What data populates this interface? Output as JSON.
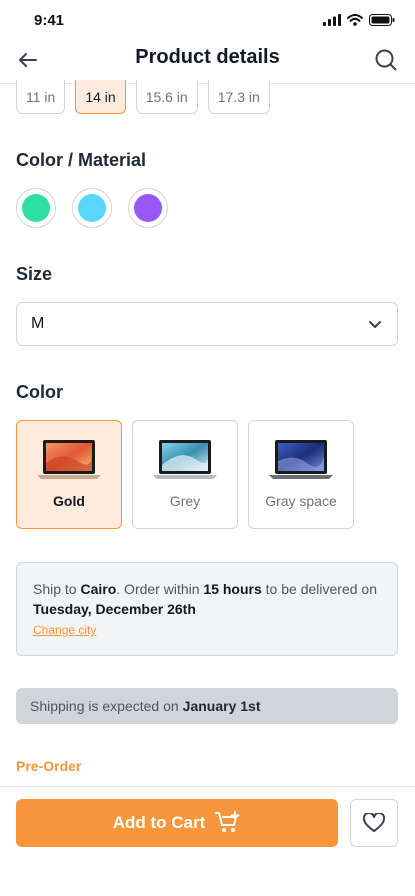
{
  "status": {
    "time": "9:41"
  },
  "header": {
    "title": "Product details"
  },
  "screen_sizes": [
    {
      "label": "11 in",
      "selected": false
    },
    {
      "label": "14 in",
      "selected": true
    },
    {
      "label": "15.6 in",
      "selected": false
    },
    {
      "label": "17.3 in",
      "selected": false
    }
  ],
  "color_material": {
    "title": "Color / Material",
    "swatches": [
      "#2ee0a5",
      "#5ad6fc",
      "#9757f6"
    ]
  },
  "size": {
    "title": "Size",
    "value": "M"
  },
  "color": {
    "title": "Color",
    "options": [
      {
        "label": "Gold",
        "selected": true
      },
      {
        "label": "Grey",
        "selected": false
      },
      {
        "label": "Gray space",
        "selected": false
      }
    ]
  },
  "shipping": {
    "t1": "Ship to ",
    "city": "Cairo",
    "t2": ". Order within ",
    "hours": "15 hours",
    "t3": " to be delivered on ",
    "date": "Tuesday, December 26th",
    "change_city": "Change city"
  },
  "expected": {
    "text": "Shipping is expected on",
    "date": "January 1st"
  },
  "preorder": "Pre-Order",
  "cta": {
    "add_to_cart": "Add to Cart"
  },
  "colors": {
    "accent": "#f7963a",
    "accent_light": "#feebdb"
  }
}
